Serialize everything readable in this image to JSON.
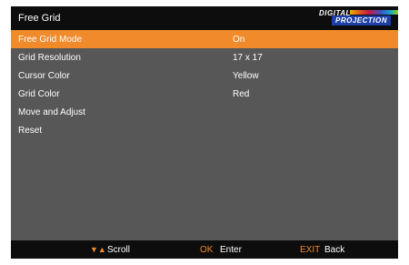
{
  "header": {
    "title": "Free Grid",
    "logo_top": "DIGITAL",
    "logo_bottom": "PROJECTION"
  },
  "menu": [
    {
      "label": "Free Grid Mode",
      "value": "On",
      "selected": true
    },
    {
      "label": "Grid Resolution",
      "value": "17 x 17"
    },
    {
      "label": "Cursor Color",
      "value": "Yellow"
    },
    {
      "label": "Grid Color",
      "value": "Red"
    },
    {
      "label": "Move and Adjust",
      "value": ""
    },
    {
      "label": "Reset",
      "value": ""
    }
  ],
  "footer": {
    "scroll_label": "Scroll",
    "ok_key": "OK",
    "ok_label": "Enter",
    "exit_key": "EXIT",
    "exit_label": "Back"
  },
  "colors": {
    "accent": "#f08a2a",
    "panel": "#575757",
    "bar": "#0d0d0d"
  },
  "icons": {
    "scroll_icons": [
      "arrow-down-icon",
      "arrow-up-icon"
    ]
  }
}
